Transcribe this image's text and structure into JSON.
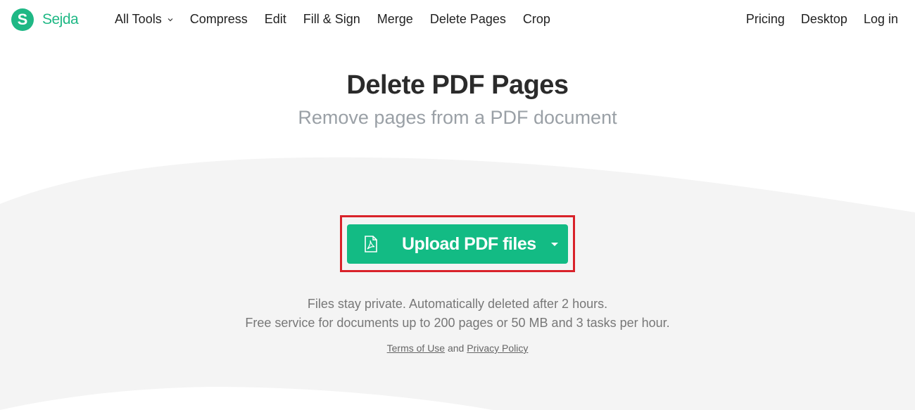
{
  "brand": {
    "logo_letter": "S",
    "name": "Sejda",
    "color": "#1fb885"
  },
  "nav": {
    "left": [
      {
        "label": "All Tools",
        "has_dropdown": true
      },
      {
        "label": "Compress"
      },
      {
        "label": "Edit"
      },
      {
        "label": "Fill & Sign"
      },
      {
        "label": "Merge"
      },
      {
        "label": "Delete Pages"
      },
      {
        "label": "Crop"
      }
    ],
    "right": [
      {
        "label": "Pricing"
      },
      {
        "label": "Desktop"
      },
      {
        "label": "Log in"
      }
    ]
  },
  "hero": {
    "title": "Delete PDF Pages",
    "subtitle": "Remove pages from a PDF document"
  },
  "upload": {
    "label": "Upload PDF files",
    "icon": "pdf-file-icon",
    "dropdown_icon": "caret-down-icon",
    "color": "#13bb84",
    "highlight_color": "#d9222a"
  },
  "info": {
    "line1": "Files stay private. Automatically deleted after 2 hours.",
    "line2": "Free service for documents up to 200 pages or 50 MB and 3 tasks per hour."
  },
  "legal": {
    "terms": "Terms of Use",
    "and": "and",
    "privacy": "Privacy Policy"
  }
}
